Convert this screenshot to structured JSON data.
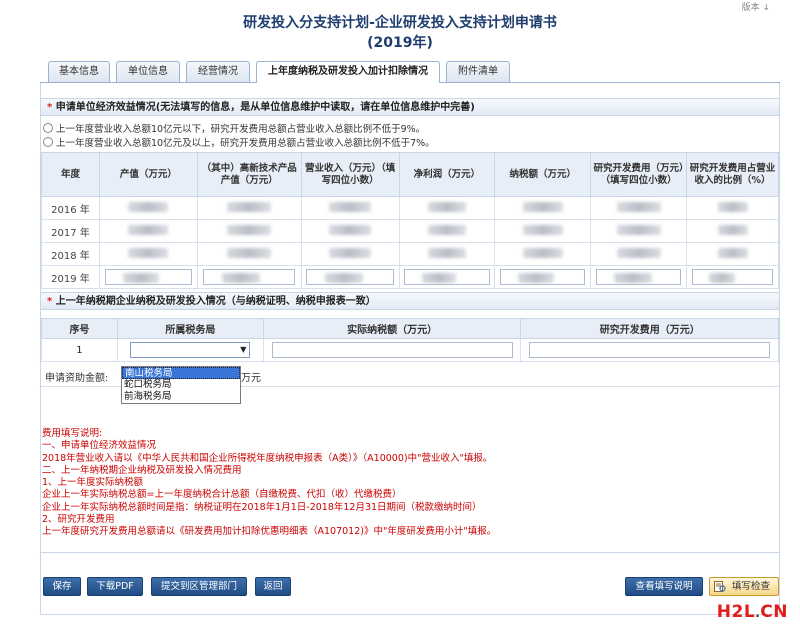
{
  "corner_text": "版本 ↓",
  "title": {
    "main": "研发投入分支持计划-企业研发投入支持计划申请书",
    "year": "(2019年)"
  },
  "tabs": [
    {
      "label": "基本信息",
      "active": false
    },
    {
      "label": "单位信息",
      "active": false
    },
    {
      "label": "经营情况",
      "active": false
    },
    {
      "label": "上年度纳税及研发投入加计扣除情况",
      "active": true
    },
    {
      "label": "附件清单",
      "active": false
    }
  ],
  "section1": {
    "star": "*",
    "title": "申请单位经济效益情况(无法填写的信息，是从单位信息维护中读取，请在单位信息维护中完善)",
    "options": [
      "上一年度营业收入总额10亿元以下，研究开发费用总额占营业收入总额比例不低于9%。",
      "上一年度营业收入总额10亿元及以上，研究开发费用总额占营业收入总额比例不低于7%。"
    ],
    "columns": [
      "年度",
      "产值（万元）",
      "（其中）高新技术产品产值（万元）",
      "营业收入（万元）（填写四位小数）",
      "净利润（万元）",
      "纳税额（万元）",
      "研究开发费用（万元）（填写四位小数）",
      "研究开发费用占营业收入的比例（%）"
    ],
    "years": [
      "2016 年",
      "2017 年",
      "2018 年",
      "2019 年"
    ]
  },
  "section2": {
    "star": "*",
    "title": "上一年纳税期企业纳税及研发投入情况（与纳税证明、纳税申报表一致）",
    "columns": [
      "序号",
      "所属税务局",
      "实际纳税额（万元）",
      "研究开发费用（万元）"
    ],
    "row_index": "1",
    "select_arrow": "▼",
    "dropdown_options": [
      "南山税务局",
      "蛇口税务局",
      "前海税务局"
    ],
    "grant_label": "申请资助金额:",
    "grant_unit": "万元"
  },
  "notes": [
    "费用填写说明:",
    "一、申请单位经济效益情况",
    "2018年营业收入请以《中华人民共和国企业所得税年度纳税申报表（A类）》（A10000)中\"营业收入\"填报。",
    "二、上一年纳税期企业纳税及研发投入情况费用",
    "1、上一年度实际纳税额",
    "企业上一年实际纳税总额=上一年度纳税合计总额（自缴税费、代扣（收）代缴税费）",
    "企业上一年实际纳税总额时间是指：纳税证明在2018年1月1日-2018年12月31日期间（税款缴纳时间）",
    "2、研究开发费用",
    "上一年度研究开发费用总额请以《研发费用加计扣除优惠明细表（A107012)》中\"年度研发费用小计\"填报。"
  ],
  "buttons": {
    "save": "保存",
    "download_pdf": "下载PDF",
    "submit": "提交到区管理部门",
    "back": "返回",
    "view_instructions": "查看填写说明",
    "check": "填写检查"
  },
  "logo": {
    "h": "H",
    "two": "2",
    "l": "L",
    "dot": ".",
    "cn": "CN"
  },
  "colors": {
    "title": "#1f3d6e",
    "button_blue": "#1f4c85",
    "note_red": "#cc0000",
    "header_bg": "#e8eef7",
    "dropdown_selected": "#3875d7"
  }
}
